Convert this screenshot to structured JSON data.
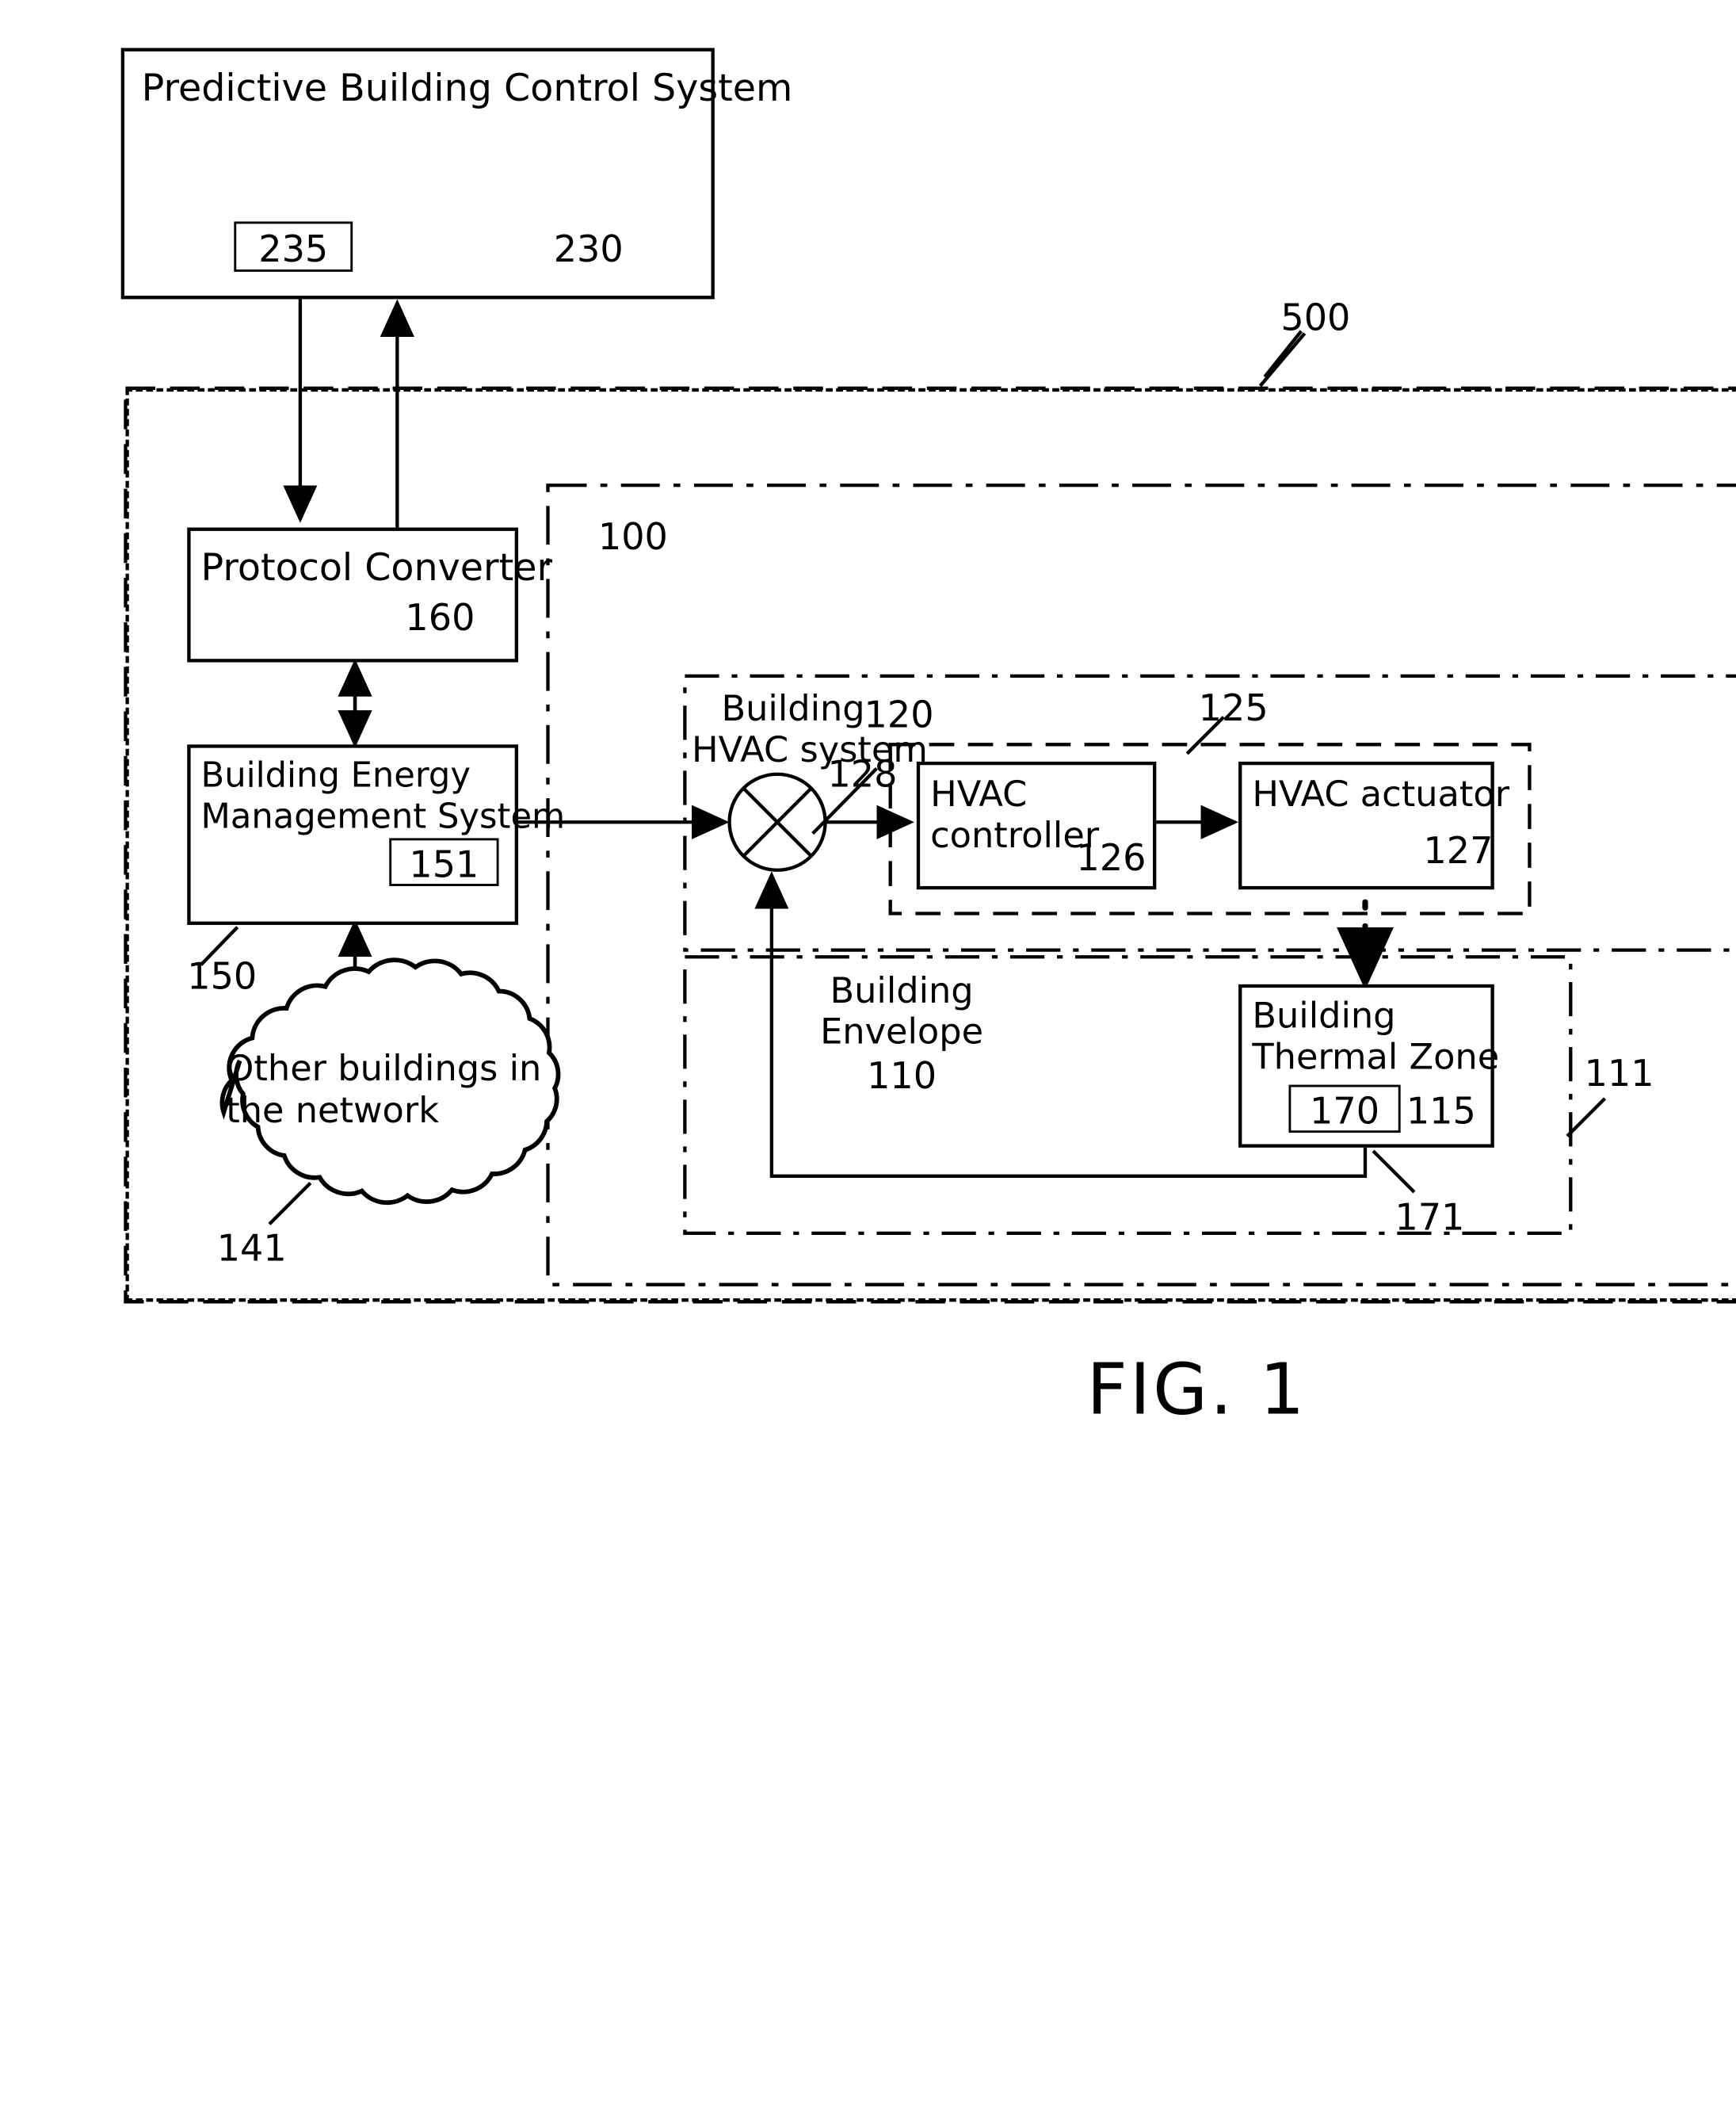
{
  "figure": {
    "caption": "FIG. 1",
    "outer_ref": "500",
    "building_ref": "100",
    "envelope_outer_ref": "111"
  },
  "blocks": {
    "predictive": {
      "title": "Predictive Building Control System",
      "inner_ref": "235",
      "ref": "230"
    },
    "protocol_converter": {
      "title": "Protocol Converter",
      "ref": "160"
    },
    "bems": {
      "title_line1": "Building Energy",
      "title_line2": "Management System",
      "inner_ref": "151",
      "ref": "150"
    },
    "cloud": {
      "line1": "Other buildings in",
      "line2": "the network",
      "ref": "141"
    },
    "hvac_system": {
      "title_line1": "Building",
      "title_line2": "HVAC system",
      "ref": "120",
      "junction_ref": "128",
      "inner_group_ref": "125"
    },
    "hvac_controller": {
      "title_line1": "HVAC",
      "title_line2": "controller",
      "ref": "126"
    },
    "hvac_actuator": {
      "title": "HVAC actuator",
      "ref": "127"
    },
    "building_envelope": {
      "title_line1": "Building",
      "title_line2": "Envelope",
      "ref": "110"
    },
    "thermal_zone": {
      "title_line1": "Building",
      "title_line2": "Thermal Zone",
      "inner_ref": "170",
      "ref": "115",
      "feedback_ref": "171"
    }
  },
  "icons": {
    "summing_junction": "summing-junction-icon",
    "cloud": "cloud-icon",
    "arrow": "arrow-icon"
  },
  "colors": {
    "stroke": "#000000",
    "background": "#ffffff"
  }
}
